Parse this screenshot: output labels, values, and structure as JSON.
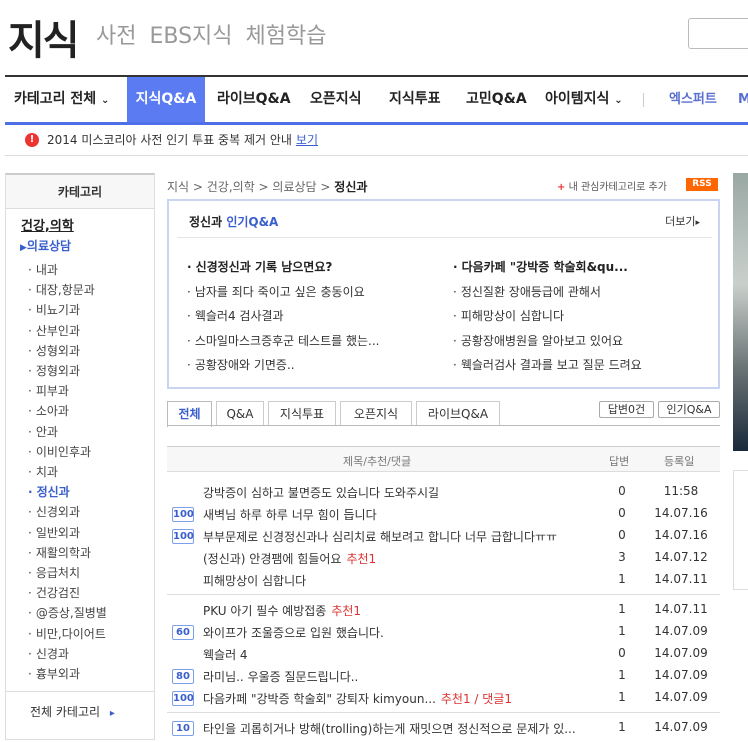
{
  "header": {
    "logo": "지식",
    "subtabs": [
      "사전",
      "EBS지식",
      "체험학습"
    ]
  },
  "gnb": {
    "items": [
      "카테고리 전체",
      "지식Q&A",
      "라이브Q&A",
      "오픈지식",
      "지식투표",
      "고민Q&A",
      "아이템지식",
      "엑스퍼트",
      "M"
    ]
  },
  "notice": {
    "text": "2014 미스코리아 사전 인기 투표 중복 제거 안내",
    "link": "보기"
  },
  "category": {
    "title": "카테고리",
    "parent": "건강,의학",
    "current": "의료상담",
    "items": [
      "내과",
      "대장,항문과",
      "비뇨기과",
      "산부인과",
      "성형외과",
      "정형외과",
      "피부과",
      "소아과",
      "안과",
      "이비인후과",
      "치과",
      "정신과",
      "신경외과",
      "일반외과",
      "재활의학과",
      "응급처치",
      "건강검진",
      "@증상,질병별",
      "비만,다이어트",
      "신경과",
      "흉부외과"
    ],
    "selected": "정신과",
    "all": "전체 카테고리"
  },
  "breadcrumb": {
    "path": "지식 > 건강,의학 > 의료상담 >",
    "current": "정신과"
  },
  "interest": "내 관심카테고리로 추가",
  "rss": "RSS",
  "popular": {
    "title_prefix": "정신과",
    "title_suffix": "인기Q&A",
    "more": "더보기",
    "left": [
      "신경정신과 기록 남으면요?",
      "남자를 죄다 죽이고 싶은 충동이요",
      "웩슬러4 검사결과",
      "스마일마스크증후군 테스트를 했는...",
      "공황장애와 기면증.."
    ],
    "right": [
      "다음카페 \"강박증 학술회&qu...",
      "정신질환 장애등급에 관해서",
      "피해망상이 심합니다",
      "공황장애병원을 알아보고 있어요",
      "웩슬러검사 결과를 보고 질문 드려요"
    ]
  },
  "tabs": [
    "전체",
    "Q&A",
    "지식투표",
    "오픈지식",
    "라이브Q&A"
  ],
  "side_buttons": [
    "답변0건",
    "인기Q&A"
  ],
  "table": {
    "headers": [
      "제목/추천/댓글",
      "답변",
      "등록일"
    ],
    "rows": [
      {
        "badge": "",
        "title": "강박증이 심하고 불면증도 있습니다 도와주시길",
        "rec": "",
        "ans": "0",
        "date": "11:58"
      },
      {
        "badge": "100",
        "title": "새벽님 하루 하루 너무 힘이 듭니다",
        "rec": "",
        "ans": "0",
        "date": "14.07.16"
      },
      {
        "badge": "100",
        "title": "부부문제로 신경정신과나 심리치료 해보려고 합니다 너무 급합니다ㅠㅠ",
        "rec": "",
        "ans": "0",
        "date": "14.07.16"
      },
      {
        "badge": "",
        "title": "(정신과) 안경팸에 힘들어요",
        "rec": "추천1",
        "ans": "3",
        "date": "14.07.12"
      },
      {
        "badge": "",
        "title": "피해망상이 심합니다",
        "rec": "",
        "ans": "1",
        "date": "14.07.11"
      },
      {
        "badge": "",
        "title": "PKU 아기 필수 예방접종",
        "rec": "추천1",
        "ans": "1",
        "date": "14.07.11"
      },
      {
        "badge": "60",
        "title": "와이프가 조울증으로 입원 했습니다.",
        "rec": "",
        "ans": "1",
        "date": "14.07.09"
      },
      {
        "badge": "",
        "title": "웩슬러 4",
        "rec": "",
        "ans": "0",
        "date": "14.07.09"
      },
      {
        "badge": "80",
        "title": "라미님.. 우울증 질문드립니다..",
        "rec": "",
        "ans": "1",
        "date": "14.07.09"
      },
      {
        "badge": "100",
        "title": "다음카페 \"강박증 학술회\" 강퇴자 kimyoun...",
        "rec": "추천1 / 댓글1",
        "ans": "1",
        "date": "14.07.09"
      },
      {
        "badge": "10",
        "title": "타인을 괴롭히거나 방해(trolling)하는게 재밋으면 정신적으로 문제가 있...",
        "rec": "",
        "ans": "1",
        "date": "14.07.09"
      }
    ]
  },
  "colors": {
    "accent": "#5a7bf2",
    "link": "#3a5fcd",
    "red": "#dd3333"
  }
}
